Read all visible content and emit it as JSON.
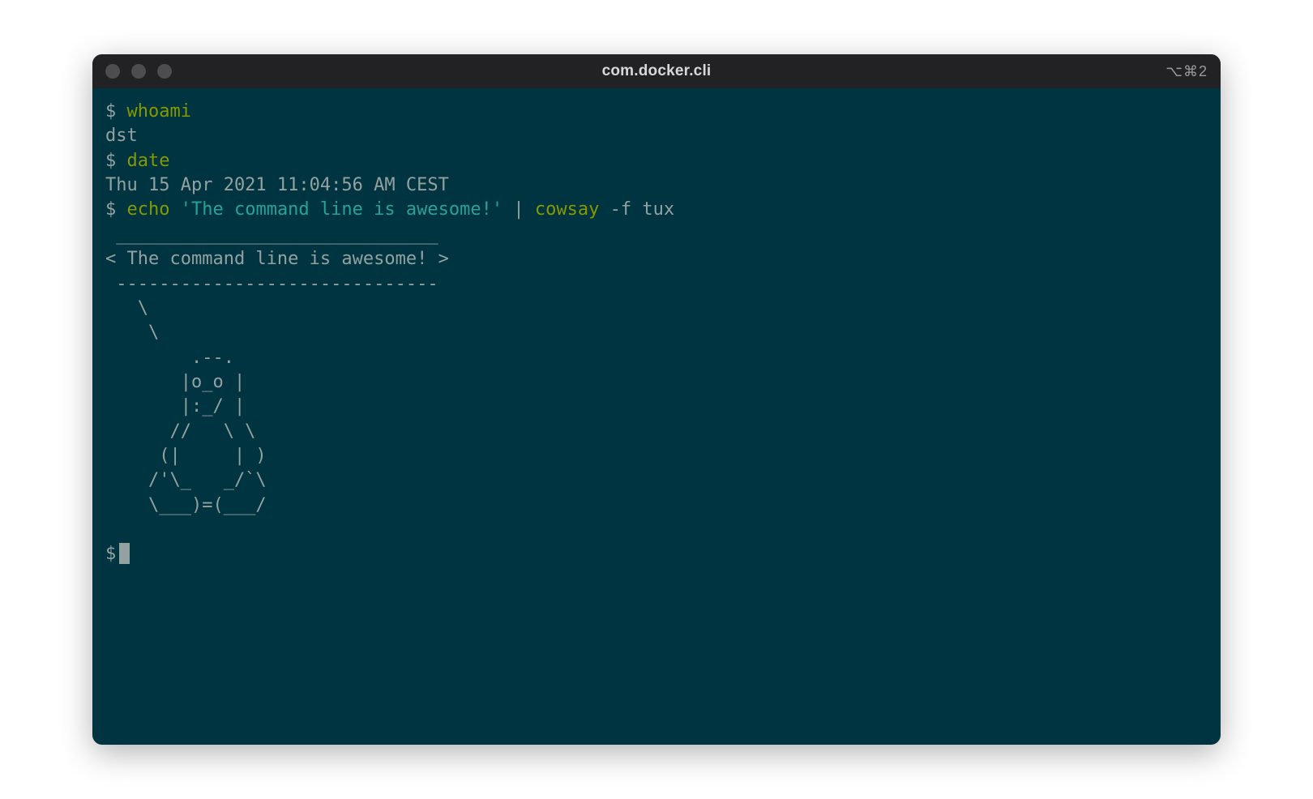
{
  "window": {
    "title": "com.docker.cli",
    "shortcut_hint": "⌥⌘2"
  },
  "prompt": "$",
  "session": [
    {
      "command": "whoami",
      "output": [
        "dst"
      ]
    },
    {
      "command": "date",
      "output": [
        "Thu 15 Apr 2021 11:04:56 AM CEST"
      ]
    },
    {
      "command_parts": {
        "cmd1": "echo",
        "string_arg": "'The command line is awesome!'",
        "pipe": "|",
        "cmd2": "cowsay",
        "flag": "-f",
        "flag_arg": "tux"
      },
      "output": [
        " ______________________________ ",
        "< The command line is awesome! >",
        " ------------------------------ ",
        "   \\",
        "    \\",
        "        .--.",
        "       |o_o |",
        "       |:_/ |",
        "      //   \\ \\",
        "     (|     | )",
        "    /'\\_   _/`\\",
        "    \\___)=(___/",
        ""
      ]
    }
  ]
}
